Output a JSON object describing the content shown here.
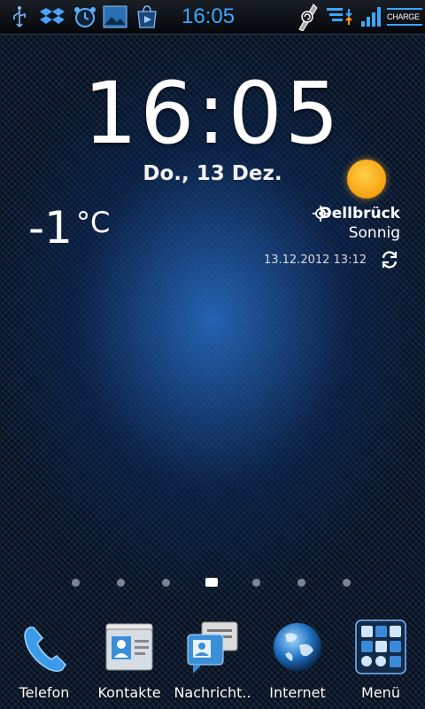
{
  "status_bar": {
    "time": "16:05",
    "charge_label": "CHARGE",
    "left_icons": [
      "usb-icon",
      "dropbox-icon",
      "alarm-clock-icon",
      "gallery-icon",
      "play-store-icon"
    ],
    "right_icons": [
      "sync-icon",
      "data-transfer-icon",
      "signal-icon"
    ]
  },
  "clock": {
    "time": "16:05",
    "date": "Do., 13 Dez."
  },
  "weather": {
    "temperature": "-1",
    "unit": "°C",
    "location": "Dellbrück",
    "condition": "Sonnig",
    "updated": "13.12.2012 13:12",
    "icon": "sun-icon"
  },
  "pager": {
    "count": 7,
    "active_index": 3
  },
  "dock": [
    {
      "label": "Telefon",
      "icon": "phone-icon"
    },
    {
      "label": "Kontakte",
      "icon": "contacts-icon"
    },
    {
      "label": "Nachricht..",
      "icon": "messages-icon"
    },
    {
      "label": "Internet",
      "icon": "globe-icon"
    },
    {
      "label": "Menü",
      "icon": "app-drawer-icon"
    }
  ],
  "colors": {
    "accent": "#3aa7ff",
    "sun": "#f6a10f"
  }
}
